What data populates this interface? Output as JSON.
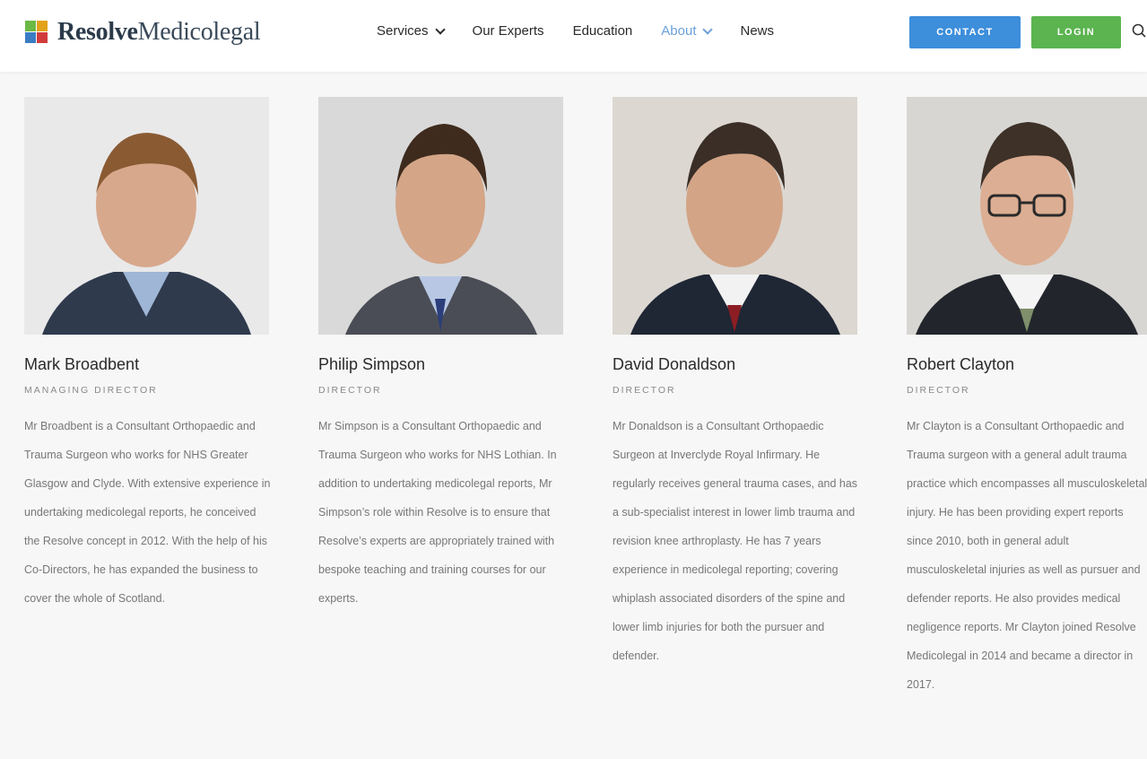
{
  "brand": {
    "bold": "Resolve",
    "light": "Medicolegal"
  },
  "nav": [
    {
      "label": "Services",
      "dropdown": true,
      "active": false
    },
    {
      "label": "Our Experts",
      "dropdown": false,
      "active": false
    },
    {
      "label": "Education",
      "dropdown": false,
      "active": false
    },
    {
      "label": "About",
      "dropdown": true,
      "active": true
    },
    {
      "label": "News",
      "dropdown": false,
      "active": false
    }
  ],
  "buttons": {
    "contact": "CONTACT",
    "login": "LOGIN"
  },
  "colors": {
    "contact": "#3d8edb",
    "login": "#5bb450",
    "active_nav": "#6aa0d8"
  },
  "team": [
    {
      "name": "Mark Broadbent",
      "role": "MANAGING DIRECTOR",
      "bio": "Mr Broadbent is a Consultant Orthopaedic and Trauma Surgeon who works for NHS Greater Glasgow and Clyde. With extensive experience in undertaking medicolegal reports, he conceived the Resolve concept in 2012. With the help of his Co-Directors, he has expanded the business to cover the whole of Scotland."
    },
    {
      "name": "Philip Simpson",
      "role": "DIRECTOR",
      "bio": "Mr Simpson is a Consultant Orthopaedic and Trauma Surgeon who works for NHS Lothian. In addition to undertaking medicolegal reports, Mr Simpson’s role within Resolve is to ensure that Resolve’s experts are appropriately trained with bespoke teaching and training courses for our experts."
    },
    {
      "name": "David Donaldson",
      "role": "DIRECTOR",
      "bio": "Mr Donaldson is a Consultant Orthopaedic Surgeon at Inverclyde Royal Infirmary. He regularly receives general trauma cases, and has a sub-specialist interest in lower limb trauma and revision knee arthroplasty. He has 7 years experience in medicolegal reporting; covering whiplash associated disorders of the spine and lower limb injuries for both the pursuer and defender."
    },
    {
      "name": "Robert Clayton",
      "role": "DIRECTOR",
      "bio": "Mr Clayton is a Consultant Orthopaedic and Trauma surgeon with a general adult trauma practice which encompasses all musculoskeletal injury. He has been providing expert reports since 2010, both in general adult musculoskeletal injuries as well as pursuer and defender reports. He also provides medical negligence reports. Mr Clayton joined Resolve Medicolegal in 2014 and became a director in 2017."
    }
  ]
}
